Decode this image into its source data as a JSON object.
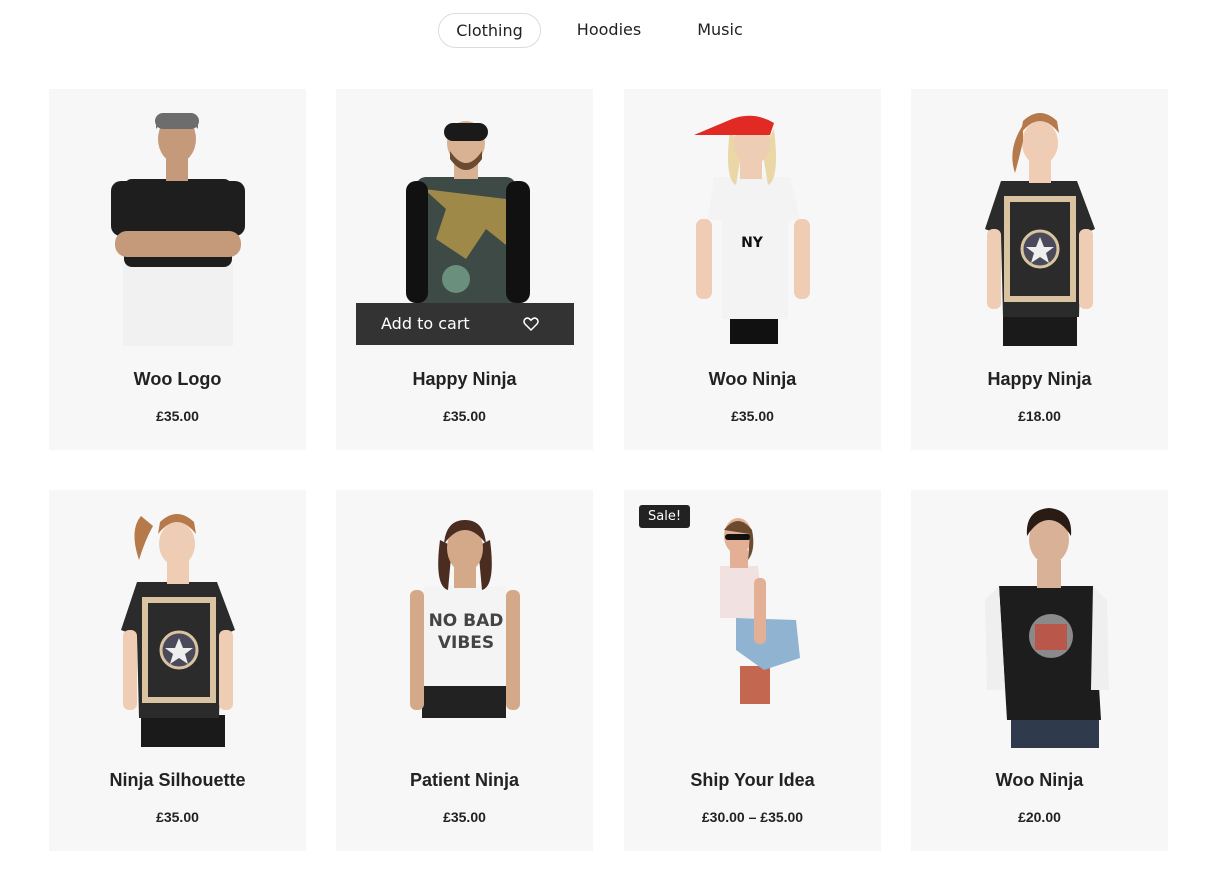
{
  "tabs": [
    {
      "label": "Clothing",
      "active": true
    },
    {
      "label": "Hoodies",
      "active": false
    },
    {
      "label": "Music",
      "active": false
    }
  ],
  "products": [
    {
      "name": "Woo Logo",
      "price": "£35.00",
      "shirt_color": "#1e1e1e",
      "bottom_color": "#f1f1f1",
      "hat_color": "#6d6d6d",
      "skin": "#c59a7b"
    },
    {
      "name": "Happy Ninja",
      "price": "£35.00",
      "shirt_color": "#3d4a45",
      "sleeve_color": "#111111",
      "hat_color": "#1a1a1a",
      "skin": "#d8b292"
    },
    {
      "name": "Woo Ninja",
      "price": "£35.00",
      "shirt_color": "#f3f3f3",
      "hat_color": "#e12a24",
      "hair": "#e9d7a8",
      "skin": "#efcdb4"
    },
    {
      "name": "Happy Ninja",
      "price": "£18.00",
      "shirt_color": "#2b2b2b",
      "hair": "#b5794a",
      "skin": "#efcdb4"
    },
    {
      "name": "Ninja Silhouette",
      "price": "£35.00",
      "shirt_color": "#2b2b2b",
      "hair": "#b5794a",
      "skin": "#efcdb4"
    },
    {
      "name": "Patient Ninja",
      "price": "£35.00",
      "shirt_color": "#f4f4f4",
      "shirt_text": [
        "NO BAD",
        "VIBES"
      ],
      "hair": "#4a2d20",
      "skin": "#d4a98a"
    },
    {
      "name": "Ship Your Idea",
      "price": "£30.00 – £35.00",
      "badge": "Sale!",
      "shirt_color": "#f2e1e1",
      "hair": "#6b4a2f",
      "skin": "#e3b095"
    },
    {
      "name": "Woo Ninja",
      "price": "£20.00",
      "shirt_color": "#1d1d1d",
      "sleeve_color": "#efefef",
      "hair": "#2a1c14",
      "skin": "#d9b196"
    }
  ],
  "hover_action": {
    "label": "Add to cart",
    "icon": "heart-icon"
  },
  "colors": {
    "card_bg": "#f7f7f7",
    "button_bg": "#333333",
    "badge_bg": "#222222",
    "text": "#222222"
  }
}
